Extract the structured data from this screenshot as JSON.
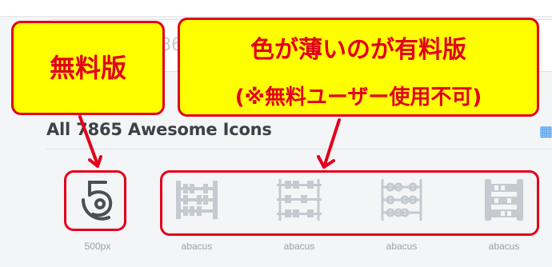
{
  "page": {
    "heading": "All 7865 Awesome Icons",
    "grid_toggle_icon": "grid-view-icon",
    "search_ghost_text": "86"
  },
  "icons": [
    {
      "label": "500px",
      "icon": "500px-icon",
      "paid": false
    },
    {
      "label": "abacus",
      "icon": "abacus-icon",
      "paid": true
    },
    {
      "label": "abacus",
      "icon": "abacus-icon",
      "paid": true
    },
    {
      "label": "abacus",
      "icon": "abacus-icon",
      "paid": true
    },
    {
      "label": "abacus",
      "icon": "abacus-icon",
      "paid": true
    }
  ],
  "annotations": {
    "free_label": "無料版",
    "paid_label_line1": "色が薄いのが有料版",
    "paid_label_line2": "(※無料ユーザー使用不可)"
  },
  "colors": {
    "callout_fill": "#ffff00",
    "callout_red": "#e2001a",
    "icon_dark": "#4a4f55",
    "icon_light": "#c5cad0",
    "accent_blue": "#2f8ff0"
  }
}
